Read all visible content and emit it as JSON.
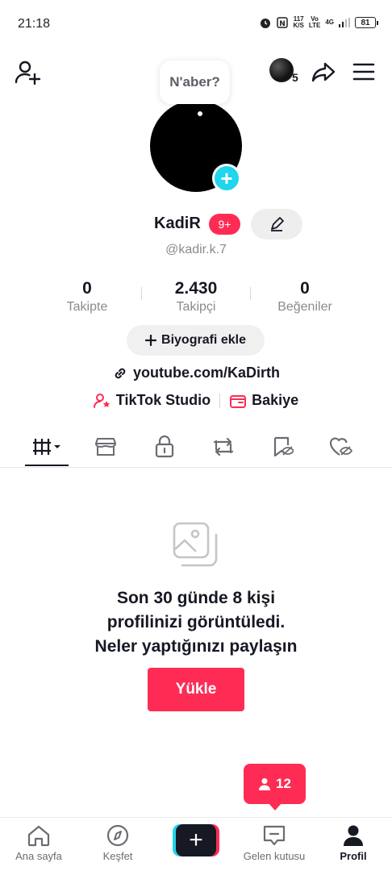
{
  "status_bar": {
    "time": "21:18",
    "net_speed": "117",
    "net_unit": "K/S",
    "volte": "Vo",
    "lte": "LTE",
    "signal": "4G",
    "battery": "81"
  },
  "top_bar": {
    "avatar_count": "5"
  },
  "note": {
    "text": "N'aber?"
  },
  "profile": {
    "name": "KadiR",
    "badge": "9+",
    "handle": "@kadir.k.7",
    "stats": [
      {
        "value": "0",
        "label": "Takipte"
      },
      {
        "value": "2.430",
        "label": "Takipçi"
      },
      {
        "value": "0",
        "label": "Beğeniler"
      }
    ],
    "bio_button": "Biyografi ekle",
    "link": "youtube.com/KaDirth",
    "tools": {
      "studio": "TikTok Studio",
      "wallet": "Bakiye"
    }
  },
  "tabs": [
    "videos",
    "shop",
    "private",
    "reposts",
    "favorites",
    "liked"
  ],
  "empty_state": {
    "line1": "Son 30 günde 8 kişi",
    "line2": "profilinizi görüntüledi.",
    "line3": "Neler yaptığınızı paylaşın",
    "button": "Yükle"
  },
  "viewers_popup": {
    "count": "12"
  },
  "bottom_nav": {
    "home": "Ana sayfa",
    "discover": "Keşfet",
    "inbox": "Gelen kutusu",
    "profile": "Profil"
  },
  "colors": {
    "accent": "#fe2c55",
    "cyan": "#20d5ec",
    "text": "#161823",
    "muted": "#8a8b91"
  }
}
